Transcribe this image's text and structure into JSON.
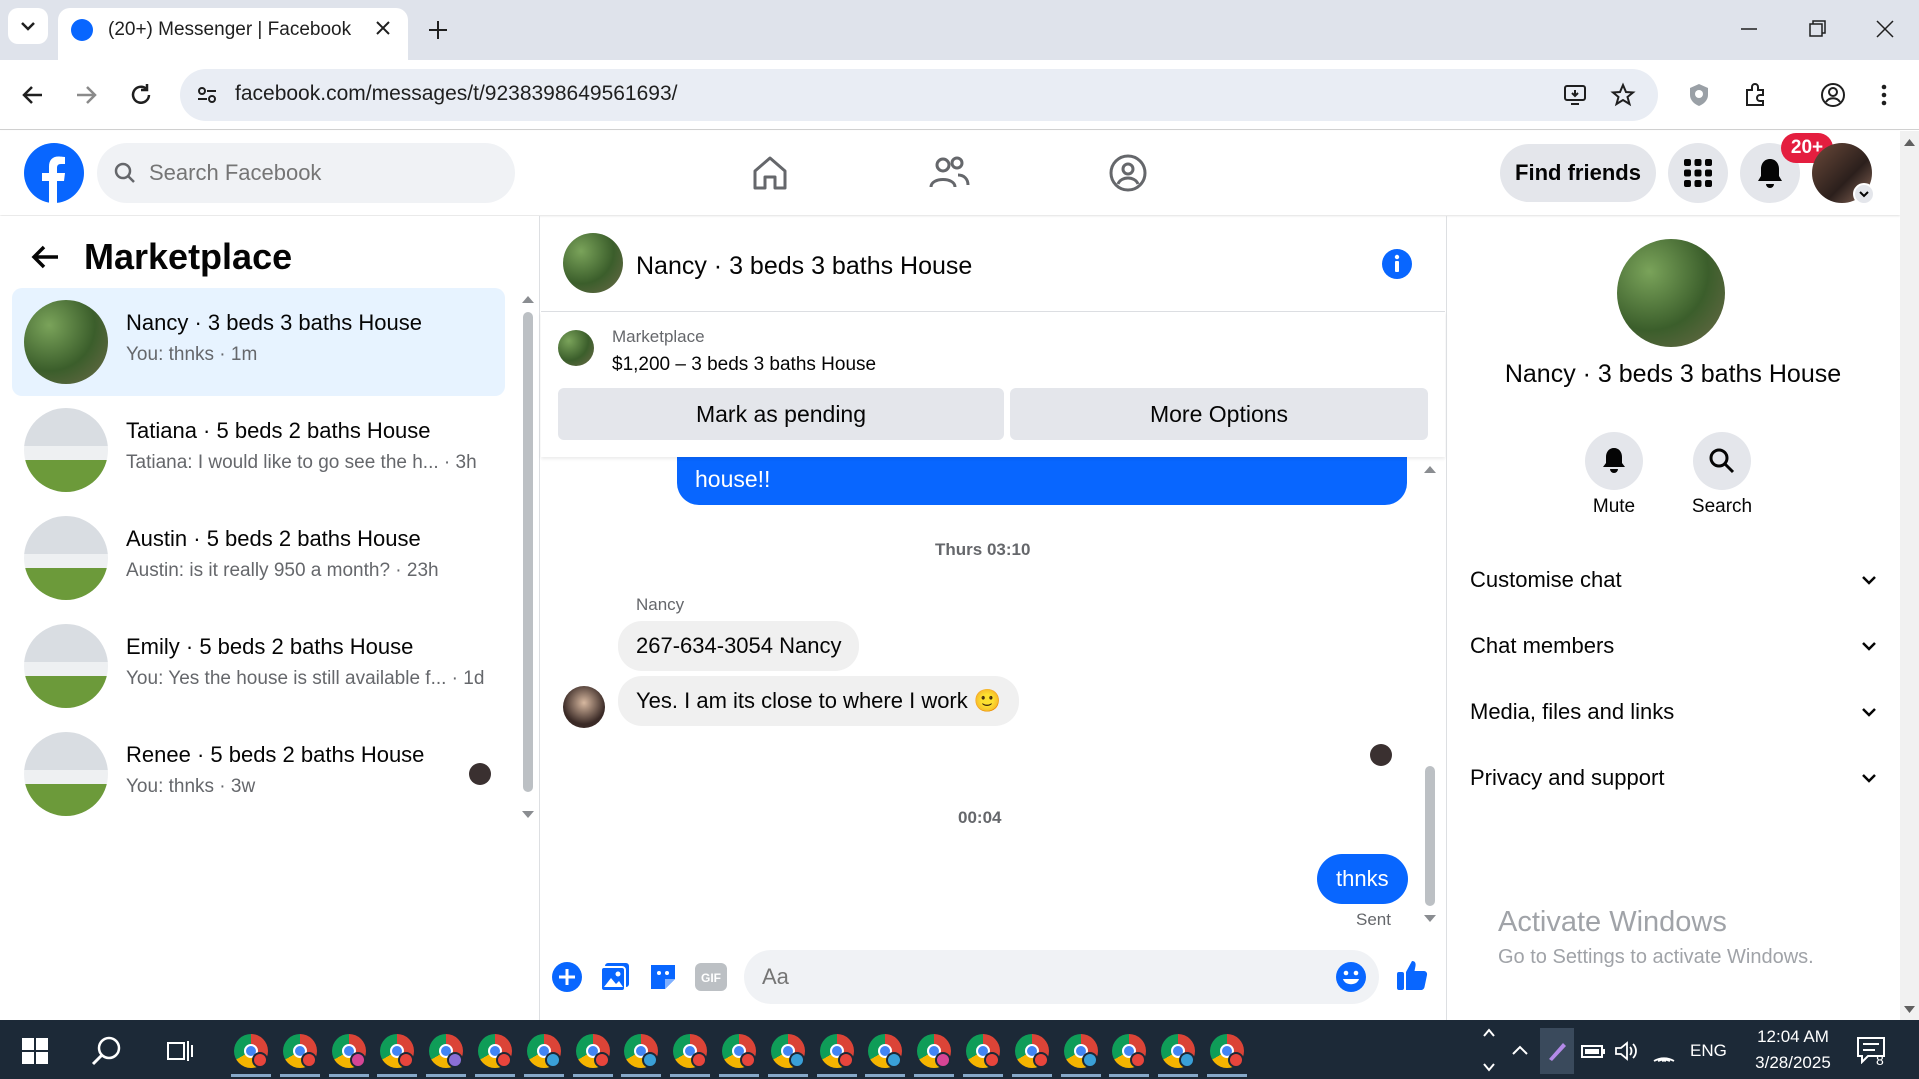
{
  "browser": {
    "tab_title": "(20+) Messenger | Facebook",
    "url": "facebook.com/messages/t/9238398649561693/"
  },
  "fb_header": {
    "search_placeholder": "Search Facebook",
    "find_friends": "Find friends",
    "notification_badge": "20+"
  },
  "left_panel": {
    "title": "Marketplace",
    "conversations": [
      {
        "name": "Nancy · 3 beds 3 baths House",
        "preview": "You: thnks · 1m",
        "active": true
      },
      {
        "name": "Tatiana · 5 beds 2 baths House",
        "preview": "Tatiana: I would like to go see the h... · 3h"
      },
      {
        "name": "Austin · 5 beds 2 baths House",
        "preview": "Austin: is it really 950 a month? · 23h"
      },
      {
        "name": "Emily · 5 beds 2 baths House",
        "preview": "You: Yes the house is still available f... · 1d"
      },
      {
        "name": "Renee · 5 beds 2 baths House",
        "preview": "You: thnks · 3w"
      }
    ]
  },
  "chat": {
    "title": "Nancy · 3 beds 3 baths House",
    "marketplace_label": "Marketplace",
    "listing": "$1,200 – 3 beds 3 baths House",
    "mark_pending": "Mark as pending",
    "more_options": "More Options",
    "partial_message_tail": "house!!",
    "timestamp_1": "Thurs 03:10",
    "sender_name": "Nancy",
    "msg_1": "267-634-3054 Nancy",
    "msg_2": "Yes. I am its close to where I work",
    "msg_2_emoji": "🙂",
    "timestamp_2": "00:04",
    "msg_out": "thnks",
    "status": "Sent",
    "composer_placeholder": "Aa"
  },
  "right_panel": {
    "name": "Nancy · 3 beds 3 baths House",
    "mute": "Mute",
    "search": "Search",
    "sections": [
      "Customise chat",
      "Chat members",
      "Media, files and links",
      "Privacy and support"
    ]
  },
  "watermark": {
    "line1": "Activate Windows",
    "line2": "Go to Settings to activate Windows."
  },
  "taskbar": {
    "lang": "ENG",
    "time": "12:04 AM",
    "date": "3/28/2025",
    "notification_count": "8"
  }
}
